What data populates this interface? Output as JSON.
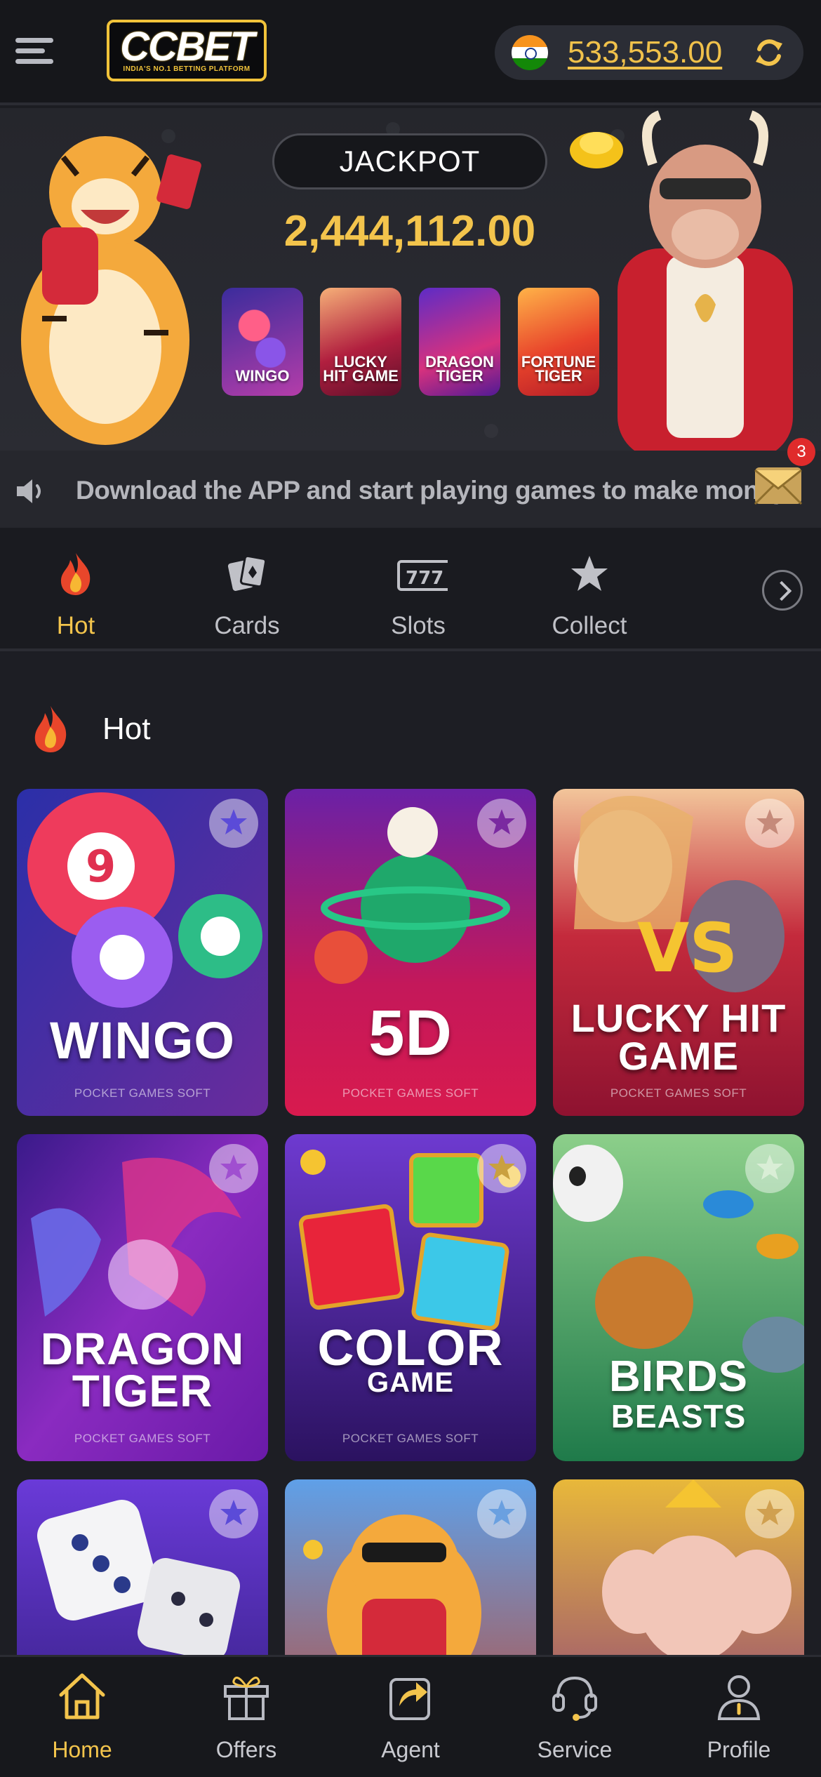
{
  "header": {
    "logo_text": "CCBET",
    "logo_tagline": "INDIA'S NO.1 BETTING PLATFORM",
    "balance": "533,553.00",
    "currency_flag": "india-flag-icon",
    "accent_color": "#f3c44c"
  },
  "banner": {
    "jackpot_label": "JACKPOT",
    "jackpot_amount": "2,444,112.00",
    "games": [
      {
        "name": "WINGO"
      },
      {
        "name": "LUCKY HIT GAME"
      },
      {
        "name": "DRAGON TIGER"
      },
      {
        "name": "FORTUNE TIGER"
      }
    ]
  },
  "marquee": {
    "text": "Download the APP and start playing games to make money",
    "mail_badge": "3"
  },
  "tabs": [
    {
      "label": "Hot",
      "icon": "flame-icon",
      "active": true
    },
    {
      "label": "Cards",
      "icon": "cards-icon",
      "active": false
    },
    {
      "label": "Slots",
      "icon": "slots-icon",
      "active": false
    },
    {
      "label": "Collect",
      "icon": "star-icon",
      "active": false
    }
  ],
  "section": {
    "title": "Hot"
  },
  "games": [
    {
      "name": "WINGO",
      "provider": "POCKET GAMES SOFT"
    },
    {
      "name": "5D",
      "provider": "POCKET GAMES SOFT"
    },
    {
      "name_line1": "LUCKY HIT",
      "name_line2": "GAME",
      "provider": "POCKET GAMES SOFT"
    },
    {
      "name_line1": "DRAGON",
      "name_line2": "TIGER",
      "provider": "POCKET GAMES SOFT"
    },
    {
      "name_line1": "COLOR",
      "name_line2": "GAME",
      "provider": "POCKET GAMES SOFT"
    },
    {
      "name_line1": "BIRDS",
      "name_line2": "BEASTS"
    }
  ],
  "bottom_nav": [
    {
      "label": "Home",
      "icon": "home-icon",
      "active": true
    },
    {
      "label": "Offers",
      "icon": "gift-icon",
      "active": false
    },
    {
      "label": "Agent",
      "icon": "share-icon",
      "active": false
    },
    {
      "label": "Service",
      "icon": "headset-icon",
      "active": false
    },
    {
      "label": "Profile",
      "icon": "user-icon",
      "active": false
    }
  ]
}
